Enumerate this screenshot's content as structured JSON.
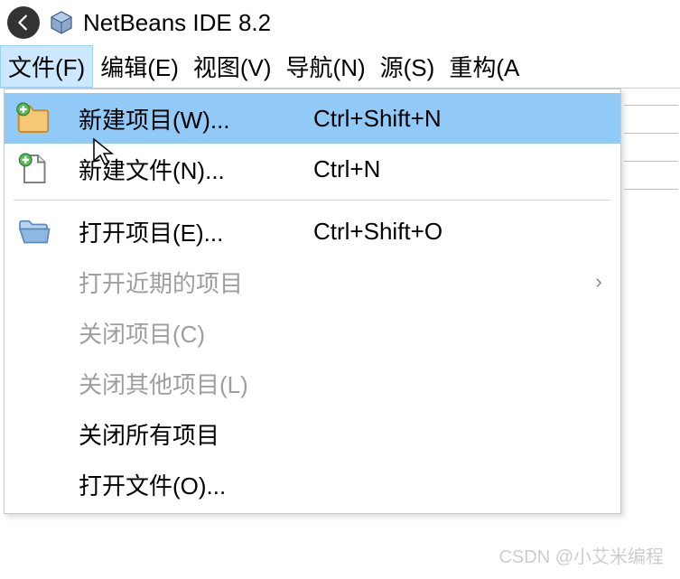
{
  "titlebar": {
    "app_title": "NetBeans IDE 8.2"
  },
  "menubar": {
    "items": [
      {
        "label": "文件(F)",
        "active": true
      },
      {
        "label": "编辑(E)",
        "active": false
      },
      {
        "label": "视图(V)",
        "active": false
      },
      {
        "label": "导航(N)",
        "active": false
      },
      {
        "label": "源(S)",
        "active": false
      },
      {
        "label": "重构(A",
        "active": false
      }
    ]
  },
  "dropdown": {
    "items": [
      {
        "icon": "new-project-icon",
        "label": "新建项目(W)...",
        "shortcut": "Ctrl+Shift+N",
        "highlighted": true,
        "disabled": false,
        "has_submenu": false
      },
      {
        "icon": "new-file-icon",
        "label": "新建文件(N)...",
        "shortcut": "Ctrl+N",
        "highlighted": false,
        "disabled": false,
        "has_submenu": false
      },
      {
        "separator": true
      },
      {
        "icon": "open-project-icon",
        "label": "打开项目(E)...",
        "shortcut": "Ctrl+Shift+O",
        "highlighted": false,
        "disabled": false,
        "has_submenu": false
      },
      {
        "icon": "",
        "label": "打开近期的项目",
        "shortcut": "",
        "highlighted": false,
        "disabled": true,
        "has_submenu": true
      },
      {
        "icon": "",
        "label": "关闭项目(C)",
        "shortcut": "",
        "highlighted": false,
        "disabled": true,
        "has_submenu": false
      },
      {
        "icon": "",
        "label": "关闭其他项目(L)",
        "shortcut": "",
        "highlighted": false,
        "disabled": true,
        "has_submenu": false
      },
      {
        "icon": "",
        "label": "关闭所有项目",
        "shortcut": "",
        "highlighted": false,
        "disabled": false,
        "has_submenu": false
      },
      {
        "icon": "",
        "label": "打开文件(O)...",
        "shortcut": "",
        "highlighted": false,
        "disabled": false,
        "has_submenu": false
      }
    ]
  },
  "watermark": "CSDN @小艾米编程"
}
